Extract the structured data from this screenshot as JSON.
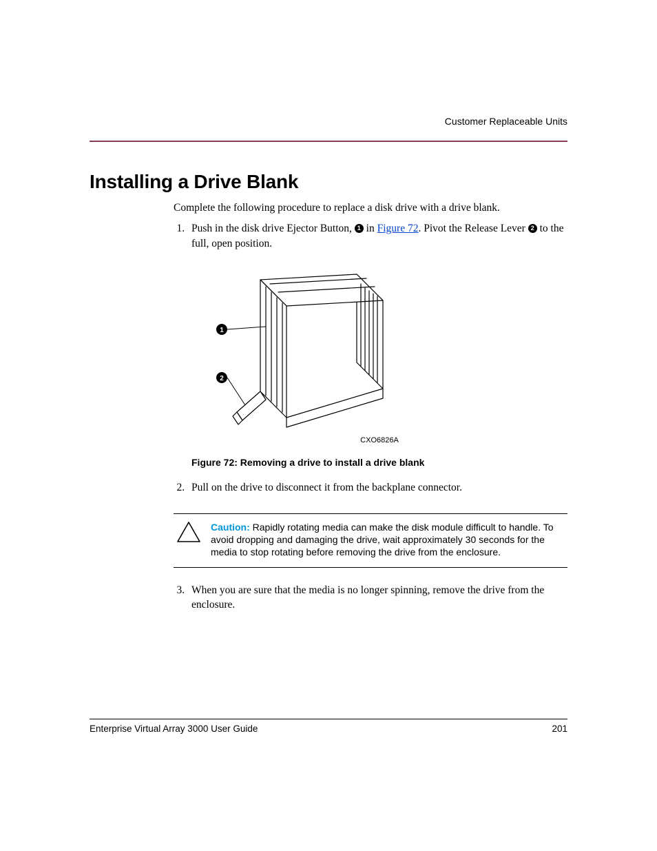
{
  "running_head": "Customer Replaceable Units",
  "section_title": "Installing a Drive Blank",
  "intro": "Complete the following procedure to replace a disk drive with a drive blank.",
  "steps": {
    "s1_a": "Push in the disk drive Ejector Button, ",
    "s1_callout1": "1",
    "s1_b": " in ",
    "s1_link": "Figure 72",
    "s1_c": ". Pivot the Release Lever ",
    "s1_callout2": "2",
    "s1_d": " to the full, open position.",
    "s2": "Pull on the drive to disconnect it from the backplane connector.",
    "s3": "When you are sure that the media is no longer spinning, remove the drive from the enclosure."
  },
  "figure": {
    "code": "CXO6826A",
    "caption": "Figure 72:  Removing a drive to install a drive blank",
    "callout1": "1",
    "callout2": "2"
  },
  "caution": {
    "label": "Caution:",
    "text": "Rapidly rotating media can make the disk module difficult to handle. To avoid dropping and damaging the drive, wait approximately 30 seconds for the media to stop rotating before removing the drive from the enclosure."
  },
  "footer": {
    "doc_title": "Enterprise Virtual Array 3000 User Guide",
    "page_no": "201"
  }
}
